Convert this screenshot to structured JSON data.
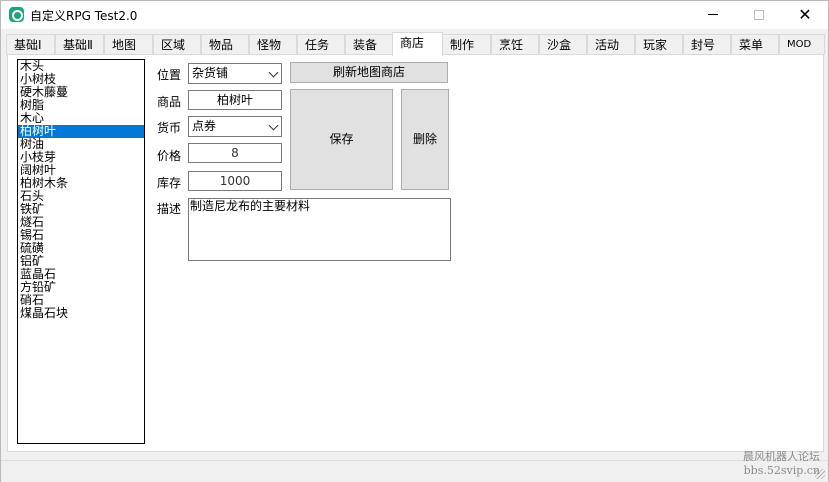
{
  "window": {
    "title": "自定义RPG  Test2.0",
    "min_label": "minimize",
    "max_label": "maximize",
    "close_glyph": "✕"
  },
  "tabs": [
    {
      "label": "基础Ⅰ"
    },
    {
      "label": "基础Ⅱ"
    },
    {
      "label": "地图"
    },
    {
      "label": "区域"
    },
    {
      "label": "物品"
    },
    {
      "label": "怪物"
    },
    {
      "label": "任务"
    },
    {
      "label": "装备"
    },
    {
      "label": "商店"
    },
    {
      "label": "制作"
    },
    {
      "label": "烹饪"
    },
    {
      "label": "沙盒"
    },
    {
      "label": "活动"
    },
    {
      "label": "玩家"
    },
    {
      "label": "封号"
    },
    {
      "label": "菜单"
    },
    {
      "label": "MOD"
    }
  ],
  "active_tab": "商店",
  "items": [
    "木头",
    "小树枝",
    "硬木藤蔓",
    "树脂",
    "木心",
    "柏树叶",
    "树油",
    "小枝芽",
    "阔树叶",
    "柏树木条",
    "石头",
    "铁矿",
    "燧石",
    "锡石",
    "硫磺",
    "铝矿",
    "蓝晶石",
    "方铅矿",
    "硝石",
    "煤晶石块"
  ],
  "selected_item": "柏树叶",
  "form": {
    "location_label": "位置",
    "location_value": "杂货铺",
    "refresh_button": "刷新地图商店",
    "goods_label": "商品",
    "goods_value": "柏树叶",
    "currency_label": "货币",
    "currency_value": "点券",
    "price_label": "价格",
    "price_value": "8",
    "stock_label": "库存",
    "stock_value": "1000",
    "desc_label": "描述",
    "desc_value": "制造尼龙布的主要材料",
    "save_button": "保存",
    "delete_button": "删除"
  },
  "watermark": {
    "line1": "晨风机器人论坛",
    "line2": "bbs.52svip.cn"
  }
}
